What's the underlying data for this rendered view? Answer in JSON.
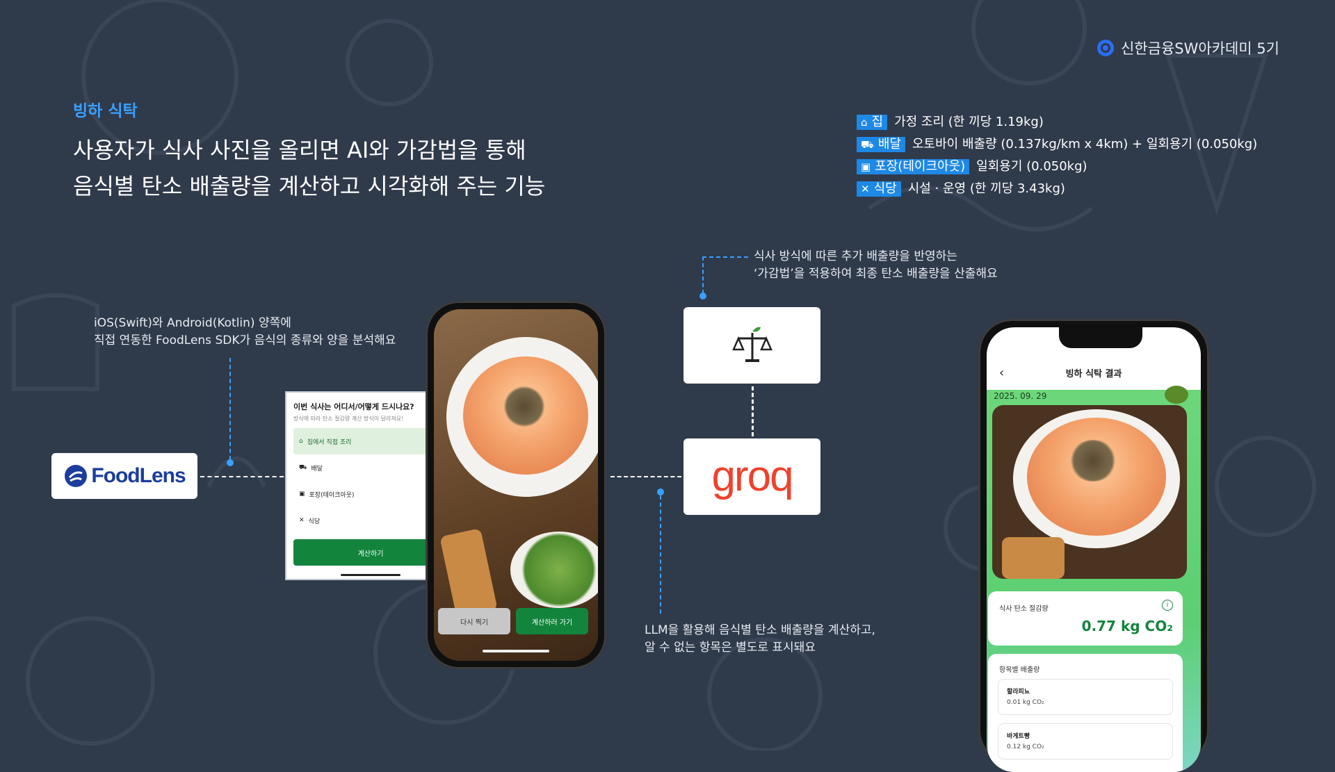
{
  "brand": {
    "label": "신한금융SW아카데미 5기"
  },
  "section_title": "빙하 식탁",
  "headline": {
    "line1": "사용자가 식사 사진을 올리면 AI와 가감법을 통해",
    "line2": "음식별 탄소 배출량을 계산하고 시각화해 주는 기능"
  },
  "legend": [
    {
      "tag": "집",
      "icon": "house-icon",
      "text": "가정 조리 (한 끼당 1.19kg)"
    },
    {
      "tag": "배달",
      "icon": "motorbike-icon",
      "text": "오토바이 배출량 (0.137kg/km x 4km)  +  일회용기 (0.050kg)"
    },
    {
      "tag": "포장(테이크아웃)",
      "icon": "bag-icon",
      "text": "일회용기 (0.050kg)"
    },
    {
      "tag": "식당",
      "icon": "utensils-icon",
      "text": "시설 · 운영 (한 끼당 3.43kg)"
    }
  ],
  "notes": {
    "sdk_line1": "iOS(Swift)와 Android(Kotlin) 양쪽에",
    "sdk_line2": "직접 연동한 FoodLens SDK가 음식의 종류와 양을 분석해요",
    "method_line1": "식사 방식에 따른 추가 배출량을 반영하는",
    "method_line2": "‘가감법’을 적용하여 최종 탄소 배출량을 산출해요",
    "llm_line1": "LLM을 활용해 음식별 탄소 배출량을 계산하고,",
    "llm_line2": "알 수 없는 항목은 별도로 표시돼요"
  },
  "logos": {
    "foodlens": "FoodLens",
    "groq": "groq",
    "scale_icon": "scale-leaf-icon"
  },
  "camera_phone": {
    "retake_label": "다시 찍기",
    "go_calc_label": "계산하러 가기"
  },
  "modal": {
    "title": "이번 식사는 어디서/어떻게 드시나요?",
    "subtitle": "방식에 따라 탄소 절감량 계산 방식이 달라져요!",
    "options": [
      {
        "label": "집에서 직접 조리",
        "icon": "house-icon",
        "selected": true
      },
      {
        "label": "배달",
        "icon": "motorbike-icon",
        "selected": false
      },
      {
        "label": "포장(테이크아웃)",
        "icon": "bag-icon",
        "selected": false
      },
      {
        "label": "식당",
        "icon": "utensils-icon",
        "selected": false
      }
    ],
    "calc_label": "계산하기"
  },
  "result_phone": {
    "back_icon": "chevron-left-icon",
    "title": "빙하 식탁 결과",
    "date": "2025. 09. 29",
    "saving_label": "식사 탄소 절감량",
    "saving_value": "0.77 kg CO₂",
    "info_icon": "info-icon",
    "breakdown_title": "항목별 배출량",
    "items": [
      {
        "name": "할라피뇨",
        "value": "0.01 kg CO₂"
      },
      {
        "name": "바게트빵",
        "value": "0.12 kg CO₂"
      }
    ]
  },
  "colors": {
    "background": "#2f3a4b",
    "accent_blue": "#1e88e5",
    "green_button": "#12843c",
    "result_green": "#6cd77a",
    "groq_red": "#f0412c"
  }
}
